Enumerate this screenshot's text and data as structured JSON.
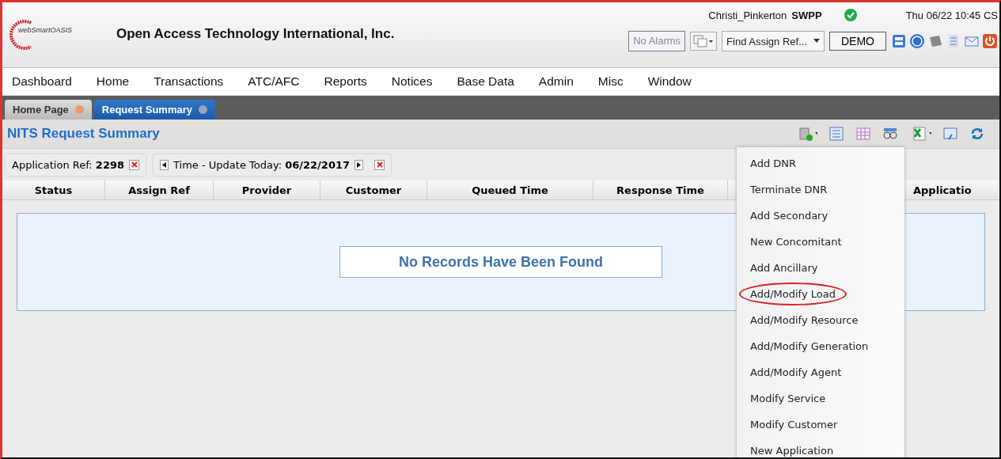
{
  "header": {
    "logo_text": "webSmartOASIS",
    "company": "Open Access Technology International, Inc.",
    "user": "Christi_Pinkerton",
    "entity": "SWPP",
    "status_ok": true,
    "datetime": "Thu 06/22 10:45 CS",
    "alarms": "No Alarms",
    "find_placeholder": "Find Assign Ref...",
    "environment": "DEMO"
  },
  "menu": [
    "Dashboard",
    "Home",
    "Transactions",
    "ATC/AFC",
    "Reports",
    "Notices",
    "Base Data",
    "Admin",
    "Misc",
    "Window"
  ],
  "tabs": [
    {
      "label": "Home Page",
      "selected": false
    },
    {
      "label": "Request Summary",
      "selected": true
    }
  ],
  "panel": {
    "title": "NITS Request Summary"
  },
  "filters": [
    {
      "kind": "plain",
      "label": "Application Ref: ",
      "value": "2298"
    },
    {
      "kind": "time",
      "label": "Time - Update Today: ",
      "value": "06/22/2017"
    }
  ],
  "table": {
    "columns": [
      "Status",
      "Assign Ref",
      "Provider",
      "Customer",
      "Queued Time",
      "Response Time",
      "Applicatio"
    ],
    "empty_message": "No Records Have Been Found"
  },
  "dropdown": {
    "items": [
      {
        "label": "Add DNR",
        "circled": false
      },
      {
        "label": "Terminate DNR",
        "circled": false
      },
      {
        "label": "Add Secondary",
        "circled": false
      },
      {
        "label": "New Concomitant",
        "circled": false
      },
      {
        "label": "Add Ancillary",
        "circled": false
      },
      {
        "label": "Add/Modify Load",
        "circled": true
      },
      {
        "label": "Add/Modify Resource",
        "circled": false
      },
      {
        "label": "Add/Modify Generation",
        "circled": false
      },
      {
        "label": "Add/Modify Agent",
        "circled": false
      },
      {
        "label": "Modify Service",
        "circled": false
      },
      {
        "label": "Modify Customer",
        "circled": false
      },
      {
        "label": "New Application",
        "circled": false
      }
    ]
  }
}
